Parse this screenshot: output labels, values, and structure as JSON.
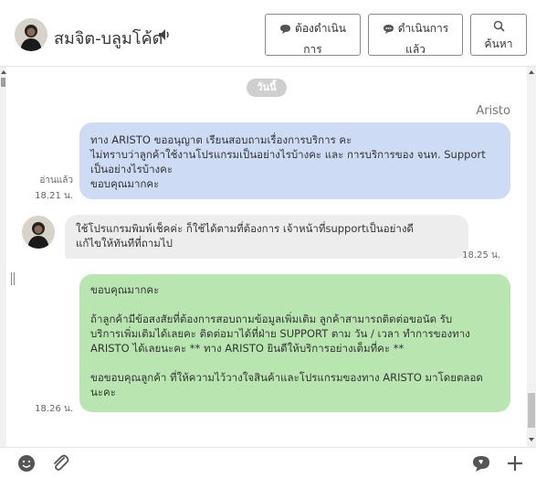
{
  "header": {
    "contact_name": "สมจิต-บลูมโค้ด",
    "buttons": {
      "pending": {
        "line1": "ต้องดำเนิน",
        "line2": "การ"
      },
      "done": {
        "line1": "ดำเนินการ",
        "line2": "แล้ว"
      },
      "search": {
        "label": "ค้นหา"
      }
    }
  },
  "chat": {
    "day_badge": "วันนี้",
    "sender_name": "Aristo",
    "messages": [
      {
        "text": "ทาง ARISTO ขออนุญาต เรียนสอบถามเรื่องการบริการ คะ\nไม่ทราบว่าลูกค้าใช้งานโปรแกรมเป็นอย่างไรบ้างคะ และ การบริการของ จนท. Support\nเป็นอย่างไรบ้างคะ\nขอบคุณมากคะ",
        "read_label": "อ่านแล้ว",
        "time": "18.21 น."
      },
      {
        "text": "ใช้โปรแกรมพิมพ์เช็คค่ะ ก็ใช้ได้ตามที่ต้องการ เจ้าหน้าที่supportเป็นอย่างดี\nแก้ไขให้ทันทีที่ถามไป",
        "time": "18.25 น."
      },
      {
        "text": "ขอบคุณมากคะ\n\nถ้าลูกค้ามีข้อสงสัยที่ต้องการสอบถามข้อมูลเพิ่มเติม ลูกค้าสามารถติดต่อขอนัด รับ\nบริการเพิ่มเติมได้เลยคะ ติดต่อมาได้ที่ฝ่าย SUPPORT ตาม วัน / เวลา ทำการของทาง\nARISTO ได้เลยนะคะ ** ทาง ARISTO ยินดีให้บริการอย่างเต็มที่คะ **\n\nขอขอบคุณลูกค้า ที่ให้ความไว้วางใจสินค้าและโปรแกรมของทาง ARISTO มาโดยตลอด\nนะคะ",
        "time": "18.26 น."
      }
    ]
  },
  "colors": {
    "outgoing_bubble": "#cddcf4",
    "incoming_bubble": "#ededed",
    "green_bubble": "#b9e5b1",
    "badge": "#cfcfcf"
  },
  "icons": {
    "speaker": "speaker-icon",
    "pending": "chat-bubble-icon",
    "done": "chat-bubble-dots-icon",
    "search": "search-icon",
    "emoji": "emoji-icon",
    "attach": "paperclip-icon",
    "sticker": "chat-icon",
    "add": "plus-icon"
  }
}
